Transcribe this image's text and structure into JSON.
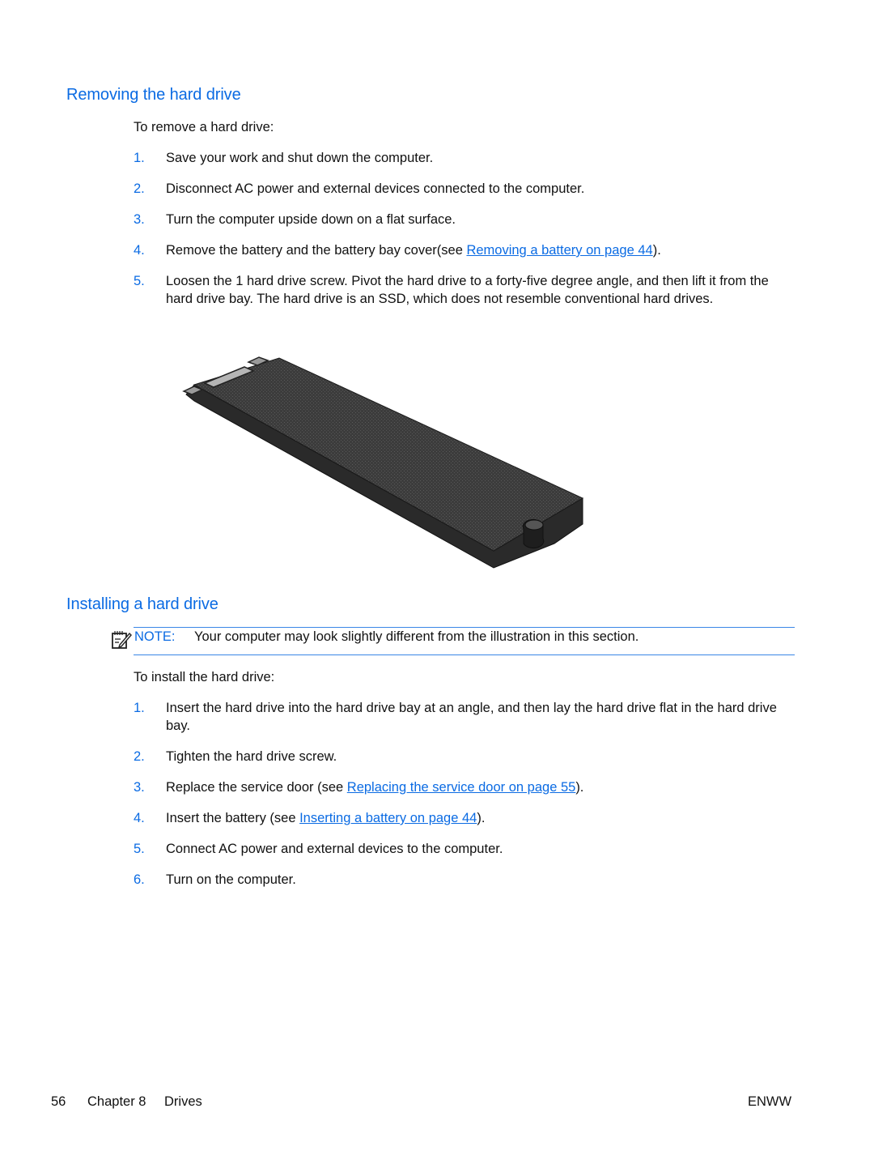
{
  "section_remove": {
    "heading": "Removing the hard drive",
    "intro": "To remove a hard drive:",
    "steps": [
      {
        "num": "1.",
        "text": "Save your work and shut down the computer."
      },
      {
        "num": "2.",
        "text": "Disconnect AC power and external devices connected to the computer."
      },
      {
        "num": "3.",
        "text": "Turn the computer upside down on a flat surface."
      },
      {
        "num": "4.",
        "text_before": "Remove the battery and the battery bay cover(see ",
        "link": "Removing a battery on page 44",
        "text_after": ")."
      },
      {
        "num": "5.",
        "text": "Loosen the 1 hard drive screw. Pivot the hard drive to a forty-five degree angle, and then lift it from the hard drive bay. The hard drive is an SSD, which does not resemble conventional hard drives."
      }
    ],
    "illustration": "ssd-m2-drive-illustration"
  },
  "section_install": {
    "heading": "Installing a hard drive",
    "note": {
      "icon": "note-pencil-icon",
      "label": "NOTE:",
      "text": "Your computer may look slightly different from the illustration in this section."
    },
    "intro": "To install the hard drive:",
    "steps": [
      {
        "num": "1.",
        "text": "Insert the hard drive into the hard drive bay at an angle, and then lay the hard drive flat in the hard drive bay."
      },
      {
        "num": "2.",
        "text": "Tighten the hard drive screw."
      },
      {
        "num": "3.",
        "text_before": "Replace the service door (see ",
        "link": "Replacing the service door on page 55",
        "text_after": ")."
      },
      {
        "num": "4.",
        "text_before": "Insert the battery (see ",
        "link": "Inserting a battery on page 44",
        "text_after": ")."
      },
      {
        "num": "5.",
        "text": "Connect AC power and external devices to the computer."
      },
      {
        "num": "6.",
        "text": "Turn on the computer."
      }
    ]
  },
  "footer": {
    "page_number": "56",
    "chapter": "Chapter 8",
    "chapter_title": "Drives",
    "right": "ENWW"
  },
  "colors": {
    "accent": "#0b6be3",
    "note_rule": "#3a86e6",
    "text": "#111111"
  }
}
